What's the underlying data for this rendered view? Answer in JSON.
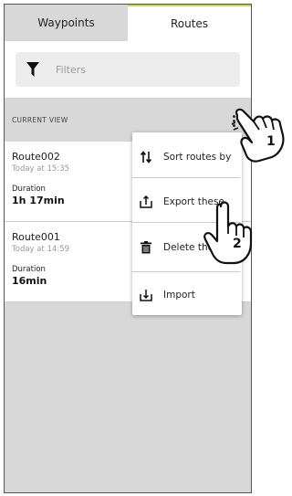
{
  "tabs": [
    {
      "label": "Waypoints",
      "active": false
    },
    {
      "label": "Routes",
      "active": true
    }
  ],
  "filter": {
    "placeholder": "Filters",
    "icon": "funnel-icon"
  },
  "current_view": {
    "label": "CURRENT VIEW"
  },
  "routes": [
    {
      "name": "Route002",
      "timestamp": "Today at 15:35",
      "duration_label": "Duration",
      "duration": "1h 17min"
    },
    {
      "name": "Route001",
      "timestamp": "Today at 14:59",
      "duration_label": "Duration",
      "duration": "16min"
    }
  ],
  "menu": [
    {
      "label": "Sort routes by",
      "icon": "sort-icon"
    },
    {
      "label": "Export these",
      "icon": "export-icon"
    },
    {
      "label": "Delete these",
      "icon": "trash-icon"
    },
    {
      "label": "Import",
      "icon": "import-icon"
    }
  ],
  "steps": [
    "1",
    "2"
  ],
  "colors": {
    "tab_accent": "#c9d840",
    "gray": "#d8d8d8"
  }
}
